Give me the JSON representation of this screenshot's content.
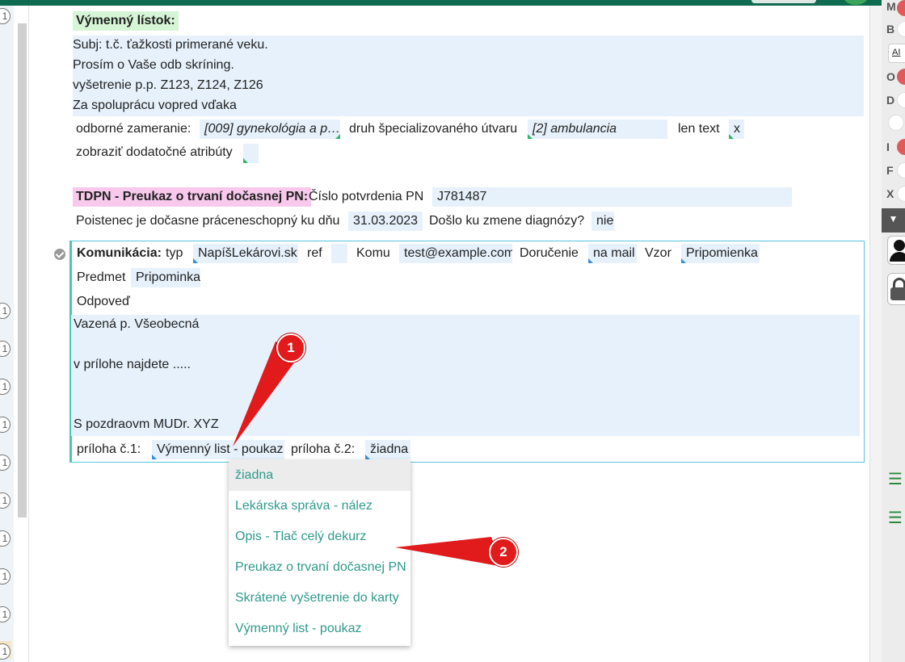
{
  "exchange_ticket": {
    "title": "Výmenný lístok:",
    "memo_lines": [
      "Subj: t.č. ťažkosti primerané veku.",
      "Prosím o Vaše odb skríning.",
      "vyšetrenie p.p. Z123, Z124, Z126",
      "Za spoluprácu vopred vďaka"
    ],
    "specialization_label": "odborné zameranie:",
    "specialization_value": "[009] gynekológia a p…",
    "unit_type_label": "druh špecializovaného útvaru",
    "unit_type_value": "[2] ambulancia",
    "text_only_label": "len text",
    "text_only_value": "x",
    "extra_attrs_label": "zobraziť dodatočné atribúty"
  },
  "tdpn": {
    "title": "TDPN - Preukaz o trvaní dočasnej PN:",
    "number_label": "Číslo potvrdenia PN",
    "number_value": "J781487",
    "until_label": "Poistenec je dočasne práceneschopný ku dňu",
    "until_value": "31.03.2023",
    "diag_change_label": "Došlo ku zmene diagnózy?",
    "diag_change_value": "nie"
  },
  "communication": {
    "title": "Komunikácia:",
    "type_label": "typ",
    "type_value": "NapíšLekárovi.sk",
    "ref_label": "ref",
    "to_label": "Komu",
    "to_value": "test@example.com",
    "delivery_label": "Doručenie",
    "delivery_value": "na mail",
    "template_label": "Vzor",
    "template_value": "Pripomienka",
    "subject_label": "Predmet",
    "subject_value": "Pripominka",
    "reply_label": "Odpoveď",
    "letter_lines": [
      "Vazená p.  Všeobecná",
      "",
      "v prílohe najdete .....",
      "",
      "",
      "S pozdraovm MUDr. XYZ"
    ],
    "attachment1_label": "príloha č.1:",
    "attachment1_value": "Výmenný list - poukaz",
    "attachment2_label": "príloha č.2:",
    "attachment2_value": "žiadna"
  },
  "dropdown_options": [
    "žiadna",
    "Lekárska správa - nález",
    "Opis - Tlač celý dekurz",
    "Preukaz o trvaní dočasnej PN",
    "Skrátené vyšetrenie do karty",
    "Výmenný list - poukaz"
  ],
  "dropdown_selected": "žiadna",
  "callouts": [
    "1",
    "2"
  ],
  "gutter_marker": "1",
  "sidebar_letters": [
    "M",
    "B",
    "O",
    "D",
    "I",
    "F",
    "X"
  ],
  "sidebar_box_text": "AI",
  "sidebar_filter_icon": "filter-icon",
  "colors": {
    "accent": "#0f6b4f",
    "field_bg": "#e6f1fb",
    "link_teal": "#2f9a8c",
    "callout_red": "#e11b1b",
    "header_green": "#d6f5d6",
    "header_pink": "#f8c9ec"
  }
}
